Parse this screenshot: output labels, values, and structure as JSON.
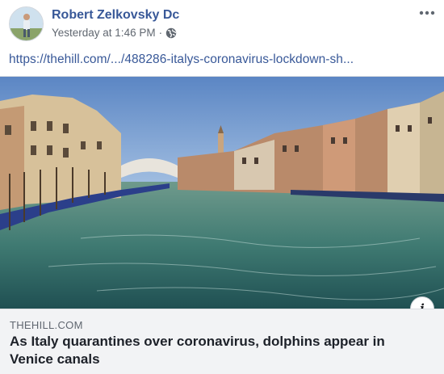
{
  "post": {
    "author": "Robert Zelkovsky Dc",
    "timestamp": "Yesterday at 1:46 PM",
    "separator": "·",
    "privacy_icon": "globe-icon",
    "more_icon": "more-options-icon",
    "link_text": "https://thehill.com/.../488286-italys-coronavirus-lockdown-sh..."
  },
  "link_preview": {
    "domain": "THEHILL.COM",
    "headline": "As Italy quarantines over coronavirus, dolphins appear in Venice canals",
    "info_icon_glyph": "i"
  },
  "colors": {
    "author_link": "#385898",
    "meta_text": "#606770",
    "caption_bg": "#f2f3f5"
  }
}
